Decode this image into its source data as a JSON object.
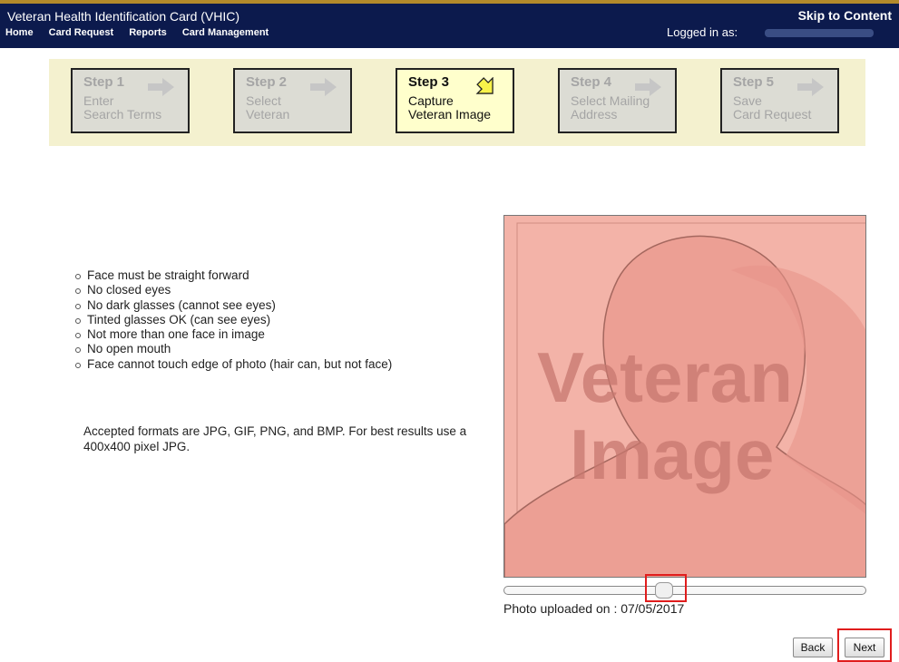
{
  "header": {
    "app_title": "Veteran Health Identification Card (VHIC)",
    "skip_link": "Skip to Content",
    "logged_in_label": "Logged in as:",
    "nav": [
      "Home",
      "Card Request",
      "Reports",
      "Card Management"
    ]
  },
  "steps": [
    {
      "number": "Step 1",
      "line1": "Enter",
      "line2": "Search Terms",
      "active": false
    },
    {
      "number": "Step 2",
      "line1": "Select",
      "line2": "Veteran",
      "active": false
    },
    {
      "number": "Step 3",
      "line1": "Capture",
      "line2": "Veteran Image",
      "active": true
    },
    {
      "number": "Step 4",
      "line1": "Select Mailing",
      "line2": "Address",
      "active": false
    },
    {
      "number": "Step 5",
      "line1": "Save",
      "line2": "Card Request",
      "active": false
    }
  ],
  "rules": [
    "Face must be straight forward",
    "No closed eyes",
    "No dark glasses (cannot see eyes)",
    "Tinted glasses OK (can see eyes)",
    "Not more than one face in image",
    "No open mouth",
    "Face cannot touch edge of photo (hair can, but not face)"
  ],
  "formats_note": "Accepted formats are JPG, GIF, PNG, and BMP. For best results use a 400x400 pixel JPG.",
  "preview": {
    "watermark_line1": "Veteran",
    "watermark_line2": "Image",
    "zoom_slider_value": 0.45
  },
  "uploaded_text": "Photo uploaded on : 07/05/2017",
  "buttons": {
    "back": "Back",
    "next": "Next"
  },
  "colors": {
    "header_bg": "#0c1a4d",
    "steps_bg": "#f4f1cf",
    "active_step": "#ffffcc",
    "highlight": "#e01d1d"
  }
}
